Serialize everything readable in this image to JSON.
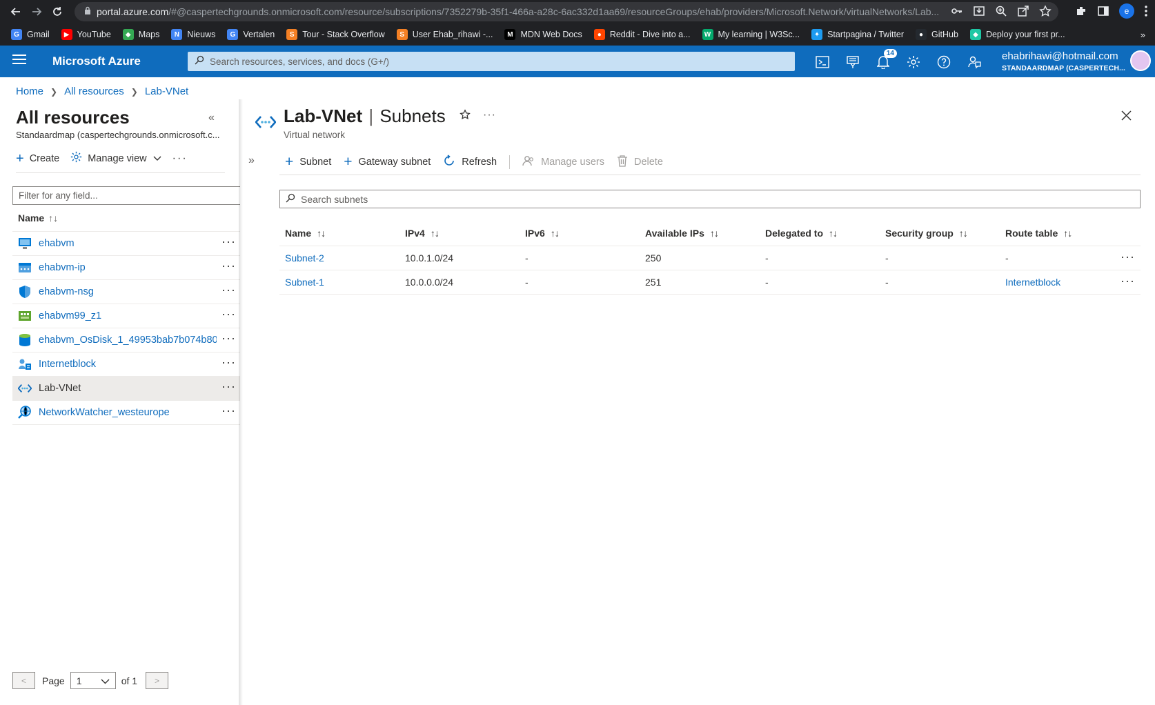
{
  "browser": {
    "url_host": "portal.azure.com",
    "url_rest": "/#@caspertechgrounds.onmicrosoft.com/resource/subscriptions/7352279b-35f1-466a-a28c-6ac332d1aa69/resourceGroups/ehab/providers/Microsoft.Network/virtualNetworks/Lab...",
    "profile_initial": "e",
    "bookmarks": [
      {
        "label": "Gmail",
        "icon": "google-icon",
        "color": "#4285f4"
      },
      {
        "label": "YouTube",
        "icon": "youtube-icon",
        "color": "#ff0000"
      },
      {
        "label": "Maps",
        "icon": "maps-icon",
        "color": "#34a853"
      },
      {
        "label": "Nieuws",
        "icon": "news-icon",
        "color": "#4285f4"
      },
      {
        "label": "Vertalen",
        "icon": "translate-icon",
        "color": "#4285f4"
      },
      {
        "label": "Tour - Stack Overflow",
        "icon": "stackoverflow-icon",
        "color": "#f48024"
      },
      {
        "label": "User Ehab_rihawi -...",
        "icon": "stackoverflow-icon",
        "color": "#f48024"
      },
      {
        "label": "MDN Web Docs",
        "icon": "mdn-icon",
        "color": "#000000"
      },
      {
        "label": "Reddit - Dive into a...",
        "icon": "reddit-icon",
        "color": "#ff4500"
      },
      {
        "label": "My learning | W3Sc...",
        "icon": "w3schools-icon",
        "color": "#04aa6d"
      },
      {
        "label": "Startpagina / Twitter",
        "icon": "twitter-icon",
        "color": "#1d9bf0"
      },
      {
        "label": "GitHub",
        "icon": "github-icon",
        "color": "#24292f"
      },
      {
        "label": "Deploy your first pr...",
        "icon": "deploy-icon",
        "color": "#1ec8a5"
      }
    ],
    "bookmarks_more": "»"
  },
  "azure": {
    "title": "Microsoft Azure",
    "search_placeholder": "Search resources, services, and docs (G+/)",
    "notification_count": "14",
    "account_email": "ehabrihawi@hotmail.com",
    "account_directory": "STANDAARDMAP (CASPERTECH..."
  },
  "breadcrumb": {
    "home": "Home",
    "all_resources": "All resources",
    "current": "Lab-VNet"
  },
  "left_panel": {
    "title": "All resources",
    "subtitle": "Standaardmap (caspertechgrounds.onmicrosoft.c...",
    "create_label": "Create",
    "manage_view_label": "Manage view",
    "filter_placeholder": "Filter for any field...",
    "column_name": "Name",
    "items": [
      {
        "name": "ehabvm",
        "icon": "virtual-machine-icon"
      },
      {
        "name": "ehabvm-ip",
        "icon": "public-ip-icon"
      },
      {
        "name": "ehabvm-nsg",
        "icon": "network-security-group-icon"
      },
      {
        "name": "ehabvm99_z1",
        "icon": "network-interface-icon"
      },
      {
        "name": "ehabvm_OsDisk_1_49953bab7b074b80...",
        "icon": "disk-icon"
      },
      {
        "name": "Internetblock",
        "icon": "route-table-icon"
      },
      {
        "name": "Lab-VNet",
        "icon": "virtual-network-icon"
      },
      {
        "name": "NetworkWatcher_westeurope",
        "icon": "network-watcher-icon"
      }
    ],
    "pager": {
      "page_label": "Page",
      "page_value": "1",
      "of_label": "of 1",
      "prev": "<",
      "next": ">"
    }
  },
  "blade": {
    "resource_name": "Lab-VNet",
    "section": "Subnets",
    "subtitle": "Virtual network",
    "commands": {
      "subnet": "Subnet",
      "gateway_subnet": "Gateway subnet",
      "refresh": "Refresh",
      "manage_users": "Manage users",
      "delete": "Delete"
    },
    "search_placeholder": "Search subnets",
    "columns": [
      "Name",
      "IPv4",
      "IPv6",
      "Available IPs",
      "Delegated to",
      "Security group",
      "Route table"
    ],
    "rows": [
      {
        "name": "Subnet-2",
        "ipv4": "10.0.1.0/24",
        "ipv6": "-",
        "available": "250",
        "delegated": "-",
        "security_group": "-",
        "route_table": "-"
      },
      {
        "name": "Subnet-1",
        "ipv4": "10.0.0.0/24",
        "ipv6": "-",
        "available": "251",
        "delegated": "-",
        "security_group": "-",
        "route_table": "Internetblock"
      }
    ]
  },
  "colors": {
    "azure_blue": "#0f6cbd",
    "browser_dark": "#202124",
    "link": "#0f6cbd"
  }
}
